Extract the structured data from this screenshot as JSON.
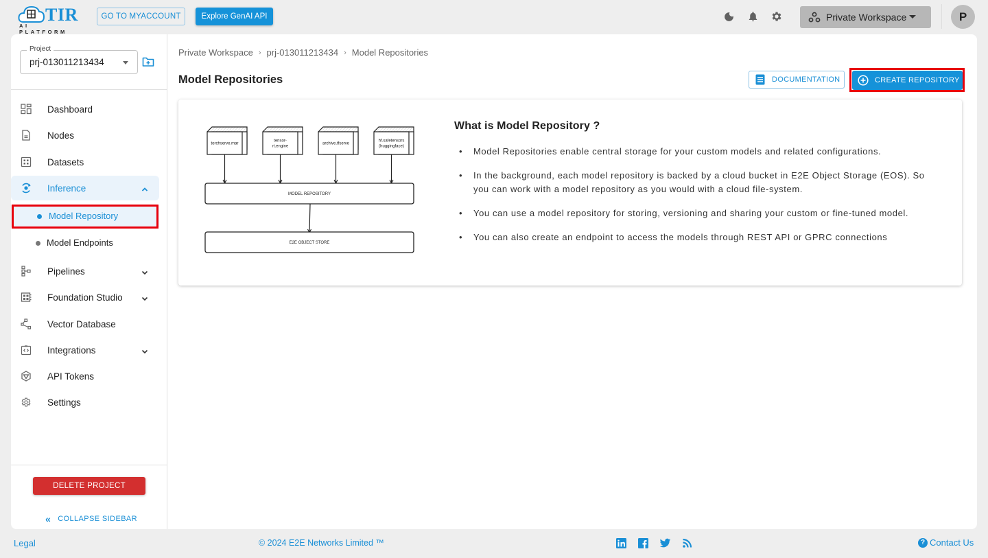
{
  "header": {
    "logo_title": "TIR",
    "logo_subtitle": "AI PLATFORM",
    "myaccount_label": "GO TO MYACCOUNT",
    "genai_label": "Explore GenAI API",
    "icons": [
      "moon-icon",
      "bell-icon",
      "gear-icon"
    ],
    "workspace_label": "Private Workspace",
    "avatar_initial": "P"
  },
  "sidebar": {
    "project_legend": "Project",
    "project_value": "prj-013011213434",
    "items": [
      {
        "label": "Dashboard",
        "icon": "dashboard-icon"
      },
      {
        "label": "Nodes",
        "icon": "document-icon"
      },
      {
        "label": "Datasets",
        "icon": "grid-icon"
      },
      {
        "label": "Inference",
        "icon": "inference-icon",
        "expanded": true,
        "active": true
      },
      {
        "label": "Pipelines",
        "icon": "pipeline-icon",
        "expandable": true
      },
      {
        "label": "Foundation Studio",
        "icon": "studio-icon",
        "expandable": true
      },
      {
        "label": "Vector Database",
        "icon": "vector-icon"
      },
      {
        "label": "Integrations",
        "icon": "integrations-icon",
        "expandable": true
      },
      {
        "label": "API Tokens",
        "icon": "token-icon"
      },
      {
        "label": "Settings",
        "icon": "settings-icon"
      }
    ],
    "sub_items": [
      {
        "label": "Model Repository",
        "active": true
      },
      {
        "label": "Model Endpoints"
      }
    ],
    "delete_label": "DELETE PROJECT",
    "collapse_label": "COLLAPSE SIDEBAR"
  },
  "main": {
    "breadcrumb": [
      "Private Workspace",
      "prj-013011213434",
      "Model Repositories"
    ],
    "breadcrumb_sep": "›",
    "title": "Model Repositories",
    "doc_label": "DOCUMENTATION",
    "create_label": "CREATE REPOSITORY",
    "diagram": {
      "sources": [
        "torchserve.mar",
        "tensor-\nrt.engine",
        "archive.tfserve",
        "hf.safetensors\n(huggingface)"
      ],
      "repository": "MODEL REPOSITORY",
      "store": "E2E OBJECT STORE"
    },
    "info_title": "What is Model Repository ?",
    "info_points": [
      "Model Repositories enable central storage for your custom models and related configurations.",
      "In the background, each model repository is backed by a cloud bucket in E2E Object Storage (EOS). So you can work with a model repository as you would with a cloud file-system.",
      "You can use a model repository for storing, versioning and sharing your custom or fine-tuned model.",
      "You can also create an endpoint to access the models through REST API or GPRC connections"
    ]
  },
  "footer": {
    "legal": "Legal",
    "copyright": "© 2024 E2E Networks Limited ™",
    "social": [
      "linkedin-icon",
      "facebook-icon",
      "twitter-icon",
      "rss-icon"
    ],
    "contact": "Contact Us"
  },
  "colors": {
    "accent": "#1592d9",
    "danger": "#d32f2f",
    "highlight": "#e8000b",
    "background": "#eeeeee"
  }
}
